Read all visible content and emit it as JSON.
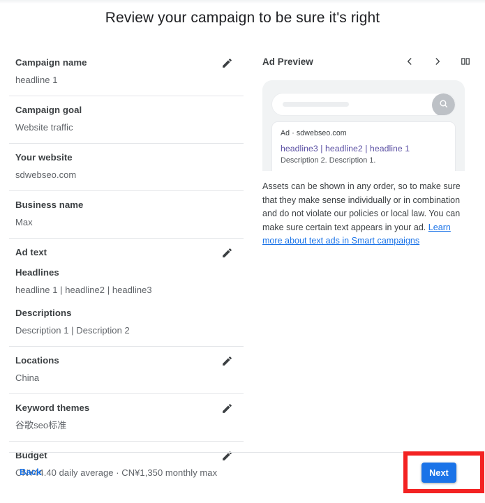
{
  "page": {
    "title": "Review your campaign to be sure it's right"
  },
  "summary": {
    "rows": [
      {
        "label": "Campaign name",
        "value": "headline 1",
        "editable": true,
        "edit_icon": "pencil-icon"
      },
      {
        "label": "Campaign goal",
        "value": "Website traffic",
        "editable": false
      },
      {
        "label": "Your website",
        "value": "sdwebseo.com",
        "editable": false
      },
      {
        "label": "Business name",
        "value": "Max",
        "editable": false
      },
      {
        "label": "Ad text",
        "editable": true,
        "edit_icon": "pencil-icon",
        "sub_label_1": "Headlines",
        "sub_value_1": "headline 1 | headline2 | headline3",
        "sub_label_2": "Descriptions",
        "sub_value_2": "Description 1 | Description 2"
      },
      {
        "label": "Locations",
        "value": "China",
        "editable": true,
        "edit_icon": "pencil-icon"
      },
      {
        "label": "Keyword themes",
        "value": "谷歌seo标准",
        "editable": true,
        "edit_icon": "pencil-icon"
      },
      {
        "label": "Budget",
        "value": "CN¥44.40 daily average · CN¥1,350 monthly max",
        "editable": true,
        "edit_icon": "pencil-icon"
      }
    ]
  },
  "preview": {
    "title": "Ad Preview",
    "nav": {
      "prev_icon": "chevron-left-icon",
      "next_icon": "chevron-right-icon",
      "layout_icon": "split-panel-icon"
    },
    "phone": {
      "search_placeholder": "",
      "search_icon": "search-icon",
      "ad": {
        "label_and_url": "Ad · sdwebseo.com",
        "headline": "headline3 | headline2 | headline 1",
        "description": "Description 2. Description 1.",
        "headline_color": "#5a4fa3"
      }
    },
    "disclaimer": {
      "text": "Assets can be shown in any order, so to make sure that they make sense individually or in combination and do not violate our policies or local law. You can make sure certain text appears in your ad. ",
      "link_text": "Learn more about text ads in Smart campaigns",
      "link_color": "#1a73e8"
    }
  },
  "footer": {
    "back_label": "Back",
    "next_label": "Next",
    "next_color": "#1a73e8",
    "highlight_color": "#f32222"
  }
}
